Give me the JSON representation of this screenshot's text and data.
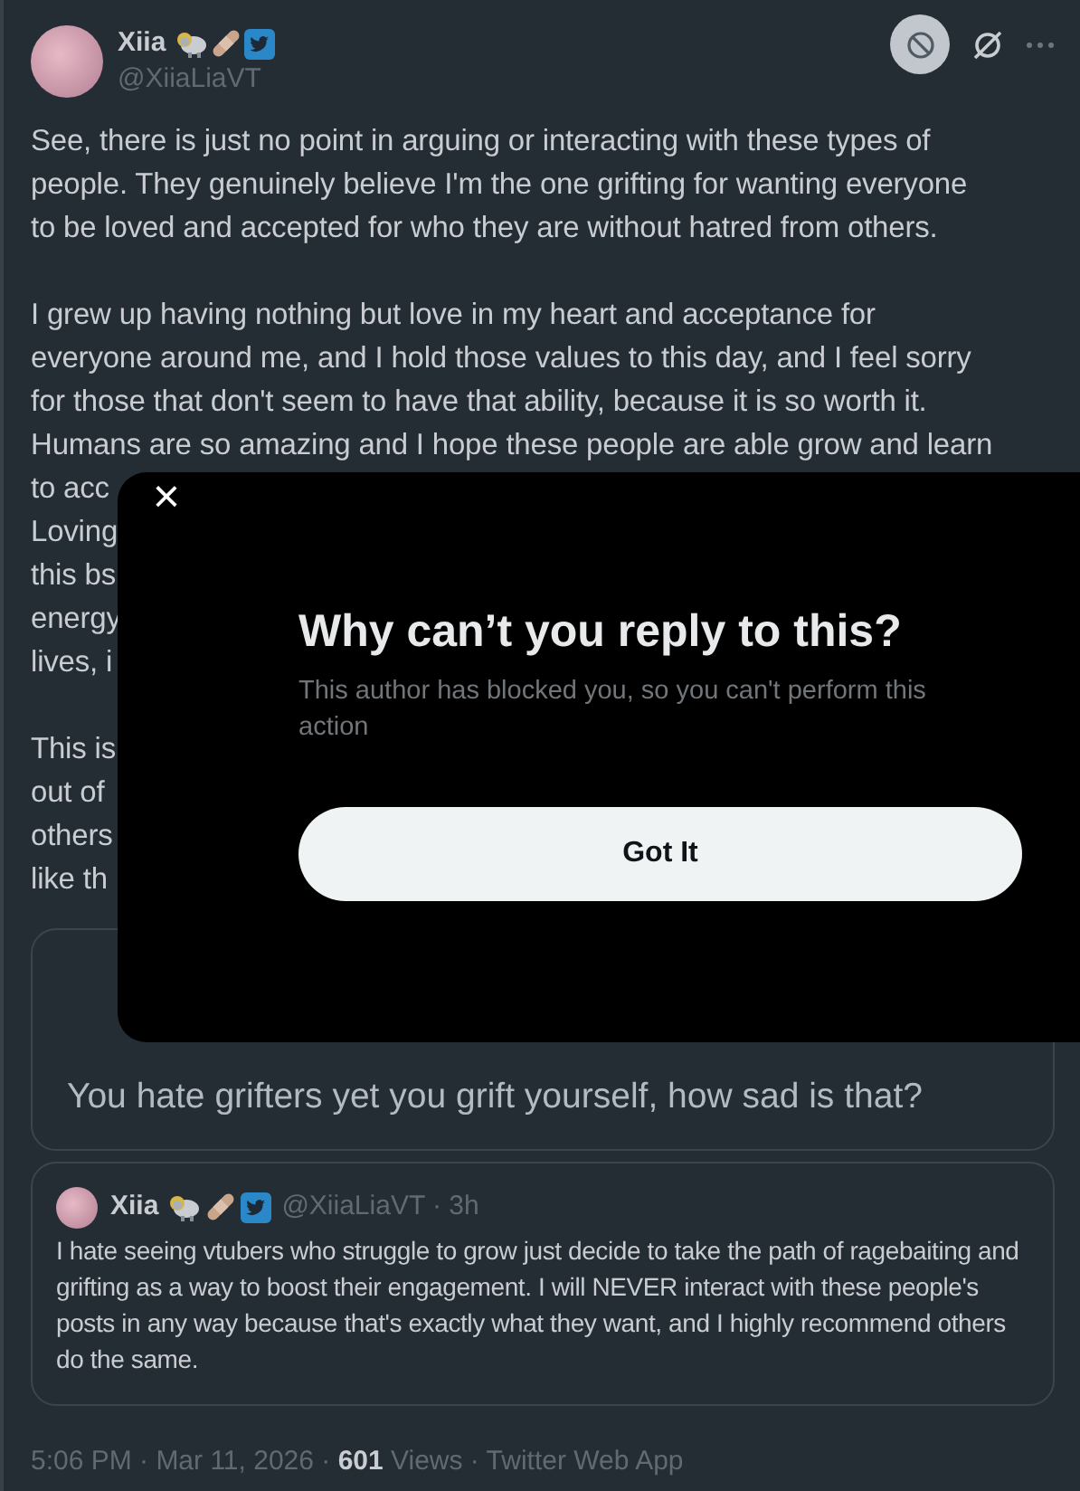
{
  "author": {
    "name": "Xiia",
    "handle": "@XiiaLiaVT"
  },
  "post": {
    "paragraphs": [
      {
        "lines": [
          "See, there is just no point in arguing or interacting with these types of",
          "people. They genuinely believe I'm the one grifting for wanting everyone",
          "to be loved and accepted for who they are without hatred from others."
        ]
      },
      {
        "lines": [
          "I grew up having nothing but love in my heart and acceptance for",
          "everyone around me, and I hold those values to this day, and I feel sorry",
          "for those that don't seem to have that ability, because it is so worth it.",
          "Humans are so amazing and I hope these people are able grow and learn",
          "to acc",
          "Loving",
          "this bs",
          "energy",
          "lives, i"
        ]
      },
      {
        "lines": [
          "This is",
          "out of",
          "others",
          "like th"
        ]
      }
    ]
  },
  "quoted_reply": {
    "text": "You hate grifters yet you grift yourself, how sad is that?"
  },
  "quoted_post": {
    "name": "Xiia",
    "handle": "@XiiaLiaVT · 3h",
    "text": "I hate seeing vtubers who struggle to grow just decide to take the path of ragebaiting and grifting as a way to boost their engagement. I will NEVER interact with these people's posts in any way because that's exactly what they want, and I highly recommend others do the same."
  },
  "footer": "5:06 PM · Mar 11, 2026 · **601** Views · Twitter Web App",
  "dialog": {
    "close": "×",
    "title": "Why can’t you reply to this?",
    "message": "This author has blocked you, so you can't perform this action",
    "button": "Got It"
  }
}
